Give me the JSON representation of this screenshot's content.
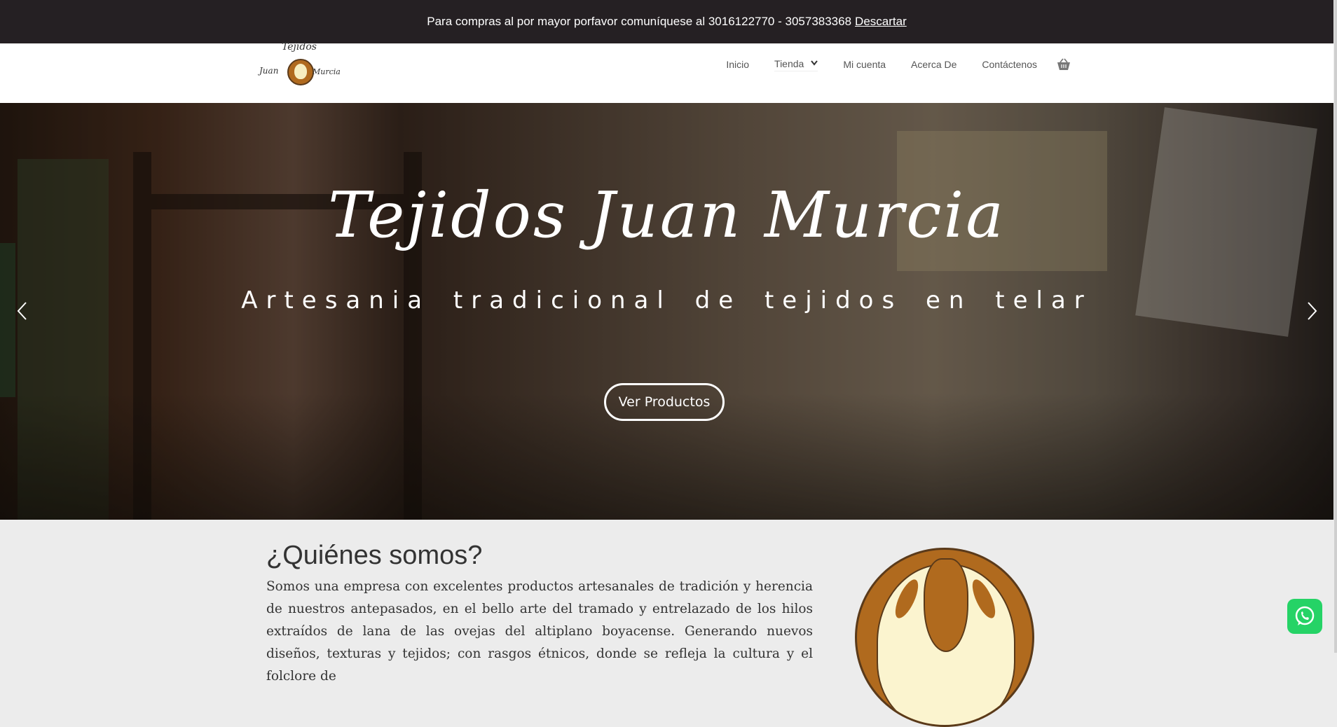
{
  "notice": {
    "text": "Para compras al por mayor porfavor comuníquese al 3016122770 - 3057383368",
    "dismiss_label": "Descartar"
  },
  "header": {
    "logo": {
      "line1": "Tejidos",
      "line2": "Juan",
      "line3": "Murcia"
    },
    "nav": [
      {
        "label": "Inicio"
      },
      {
        "label": "Tienda"
      },
      {
        "label": "Mi cuenta"
      },
      {
        "label": "Acerca De"
      },
      {
        "label": "Contáctenos"
      }
    ],
    "cart_icon": "basket-icon"
  },
  "hero": {
    "title": "Tejidos Juan Murcia",
    "subtitle": "Artesania tradicional de tejidos en telar",
    "cta_label": "Ver Productos",
    "prev_icon": "chevron-left-icon",
    "next_icon": "chevron-right-icon"
  },
  "about": {
    "heading": "¿Quiénes somos?",
    "paragraph": "Somos una empresa con excelentes productos artesanales de tradición y herencia de nuestros antepasados, en el bello arte del tramado y entrelazado de los hilos extraídos de lana de las ovejas del altiplano boyacense. Generando nuevos diseños, texturas y tejidos; con rasgos étnicos, donde se refleja la cultura y el folclore de"
  },
  "whatsapp_icon": "whatsapp-icon",
  "colors": {
    "notice_bg": "#252023",
    "accent_brown": "#b06a1e",
    "whatsapp_green": "#25d366"
  }
}
